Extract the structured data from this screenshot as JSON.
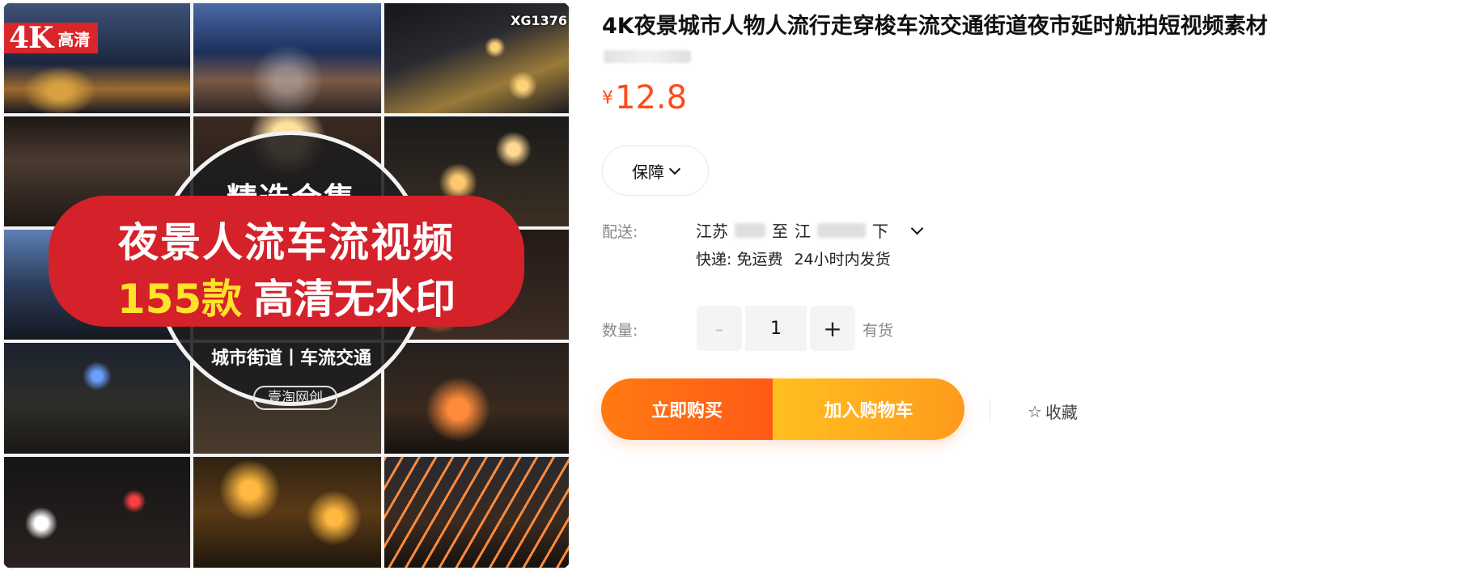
{
  "product_image": {
    "badge_big": "4K",
    "badge_small": "高清",
    "sku_code": "XG1376",
    "circle_title": "精选合集",
    "banner_line1": "夜景人流车流视频",
    "banner_line2_yellow": "155款",
    "banner_line2_white": "高清无水印",
    "circle_sub": "城市街道丨车流交通",
    "circle_brand": "壹淘网创"
  },
  "title": "4K夜景城市人物人流行走穿梭车流交通街道夜市延时航拍短视频素材",
  "price": {
    "currency": "¥",
    "value": "12.8"
  },
  "guarantee_label": "保障",
  "shipping": {
    "label": "配送:",
    "from": "江苏",
    "to_word": "至",
    "to": "江",
    "to_tail": "下",
    "method": "快递: 免运费",
    "dispatch": "24小时内发货"
  },
  "quantity": {
    "label": "数量:",
    "minus": "-",
    "value": "1",
    "plus": "+",
    "stock": "有货"
  },
  "buttons": {
    "buy_now": "立即购买",
    "add_cart": "加入购物车",
    "favorite": "收藏"
  },
  "icons": [
    "chevron-down-icon",
    "star-outline-icon"
  ],
  "colors": {
    "price": "#ff4a1a",
    "buy_now": "#ff6a14",
    "add_cart": "#ffb01e"
  }
}
